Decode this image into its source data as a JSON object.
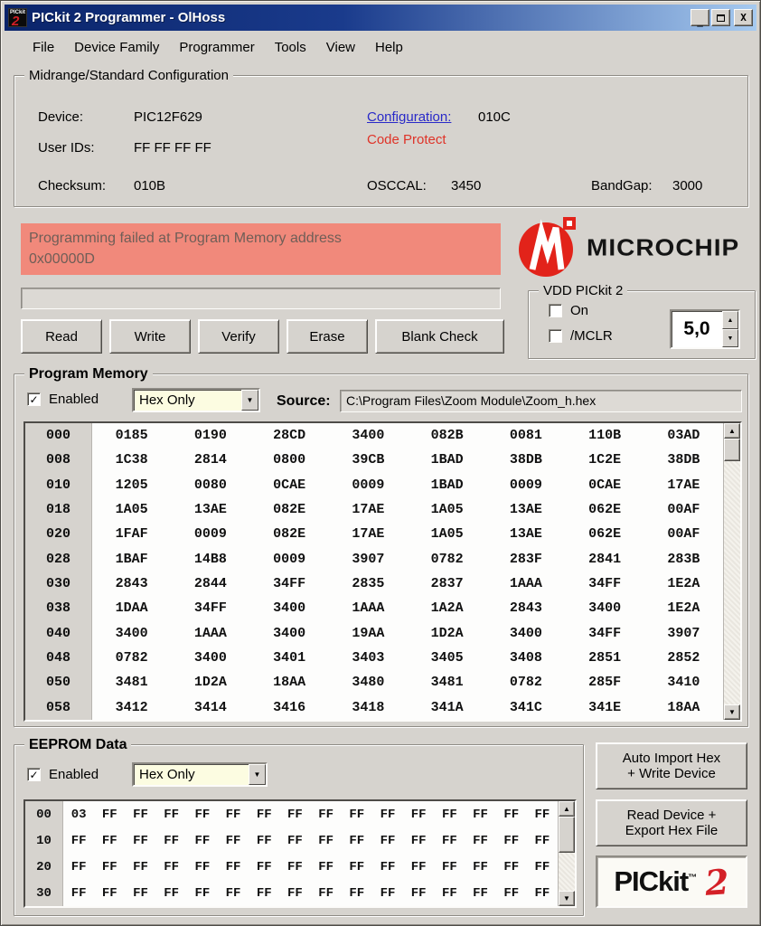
{
  "window": {
    "title": "PICkit 2 Programmer - OlHoss",
    "icon_top": "PICkit",
    "icon_two": "2",
    "minimize_glyph": "_",
    "close_glyph": "X"
  },
  "menu": {
    "items": [
      "File",
      "Device Family",
      "Programmer",
      "Tools",
      "View",
      "Help"
    ]
  },
  "config": {
    "legend": "Midrange/Standard Configuration",
    "device_label": "Device:",
    "device_value": "PIC12F629",
    "user_ids_label": "User IDs:",
    "user_ids_value": "FF FF FF FF",
    "checksum_label": "Checksum:",
    "checksum_value": "010B",
    "configuration_label": "Configuration:",
    "configuration_value": "010C",
    "code_protect_text": "Code Protect",
    "osccal_label": "OSCCAL:",
    "osccal_value": "3450",
    "bandgap_label": "BandGap:",
    "bandgap_value": "3000"
  },
  "status": {
    "message_line1": "Programming failed at Program Memory address",
    "message_line2": "0x00000D",
    "background_color": "#f1897b"
  },
  "actions": {
    "read": "Read",
    "write": "Write",
    "verify": "Verify",
    "erase": "Erase",
    "blank_check": "Blank Check"
  },
  "microchip_logo": {
    "brand": "Microchip",
    "wordmark": "MICROCHIP"
  },
  "vdd": {
    "legend": "VDD PICkit 2",
    "on_label": "On",
    "mclr_label": "/MCLR",
    "voltage_value": "5,0"
  },
  "program_memory": {
    "legend": "Program Memory",
    "enabled_label": "Enabled",
    "enabled_checked": "✓",
    "view_mode_value": "Hex Only",
    "source_label": "Source:",
    "source_path": "C:\\Program Files\\Zoom Module\\Zoom_h.hex",
    "rows": [
      {
        "addr": "000",
        "values": [
          "0185",
          "0190",
          "28CD",
          "3400",
          "082B",
          "0081",
          "110B",
          "03AD"
        ]
      },
      {
        "addr": "008",
        "values": [
          "1C38",
          "2814",
          "0800",
          "39CB",
          "1BAD",
          "38DB",
          "1C2E",
          "38DB"
        ]
      },
      {
        "addr": "010",
        "values": [
          "1205",
          "0080",
          "0CAE",
          "0009",
          "1BAD",
          "0009",
          "0CAE",
          "17AE"
        ]
      },
      {
        "addr": "018",
        "values": [
          "1A05",
          "13AE",
          "082E",
          "17AE",
          "1A05",
          "13AE",
          "062E",
          "00AF"
        ]
      },
      {
        "addr": "020",
        "values": [
          "1FAF",
          "0009",
          "082E",
          "17AE",
          "1A05",
          "13AE",
          "062E",
          "00AF"
        ]
      },
      {
        "addr": "028",
        "values": [
          "1BAF",
          "14B8",
          "0009",
          "3907",
          "0782",
          "283F",
          "2841",
          "283B"
        ]
      },
      {
        "addr": "030",
        "values": [
          "2843",
          "2844",
          "34FF",
          "2835",
          "2837",
          "1AAA",
          "34FF",
          "1E2A"
        ]
      },
      {
        "addr": "038",
        "values": [
          "1DAA",
          "34FF",
          "3400",
          "1AAA",
          "1A2A",
          "2843",
          "3400",
          "1E2A"
        ]
      },
      {
        "addr": "040",
        "values": [
          "3400",
          "1AAA",
          "3400",
          "19AA",
          "1D2A",
          "3400",
          "34FF",
          "3907"
        ]
      },
      {
        "addr": "048",
        "values": [
          "0782",
          "3400",
          "3401",
          "3403",
          "3405",
          "3408",
          "2851",
          "2852"
        ]
      },
      {
        "addr": "050",
        "values": [
          "3481",
          "1D2A",
          "18AA",
          "3480",
          "3481",
          "0782",
          "285F",
          "3410"
        ]
      },
      {
        "addr": "058",
        "values": [
          "3412",
          "3414",
          "3416",
          "3418",
          "341A",
          "341C",
          "341E",
          "18AA"
        ]
      }
    ]
  },
  "eeprom": {
    "legend": "EEPROM Data",
    "enabled_label": "Enabled",
    "enabled_checked": "✓",
    "view_mode_value": "Hex Only",
    "rows": [
      {
        "addr": "00",
        "values": [
          "03",
          "FF",
          "FF",
          "FF",
          "FF",
          "FF",
          "FF",
          "FF",
          "FF",
          "FF",
          "FF",
          "FF",
          "FF",
          "FF",
          "FF",
          "FF"
        ]
      },
      {
        "addr": "10",
        "values": [
          "FF",
          "FF",
          "FF",
          "FF",
          "FF",
          "FF",
          "FF",
          "FF",
          "FF",
          "FF",
          "FF",
          "FF",
          "FF",
          "FF",
          "FF",
          "FF"
        ]
      },
      {
        "addr": "20",
        "values": [
          "FF",
          "FF",
          "FF",
          "FF",
          "FF",
          "FF",
          "FF",
          "FF",
          "FF",
          "FF",
          "FF",
          "FF",
          "FF",
          "FF",
          "FF",
          "FF"
        ]
      },
      {
        "addr": "30",
        "values": [
          "FF",
          "FF",
          "FF",
          "FF",
          "FF",
          "FF",
          "FF",
          "FF",
          "FF",
          "FF",
          "FF",
          "FF",
          "FF",
          "FF",
          "FF",
          "FF"
        ]
      }
    ]
  },
  "side_actions": {
    "auto_import_line1": "Auto Import Hex",
    "auto_import_line2": "+ Write Device",
    "read_export_line1": "Read Device +",
    "read_export_line2": "Export Hex File"
  },
  "pickit_logo": {
    "name": "PICkit",
    "tm": "™",
    "two": "2"
  }
}
